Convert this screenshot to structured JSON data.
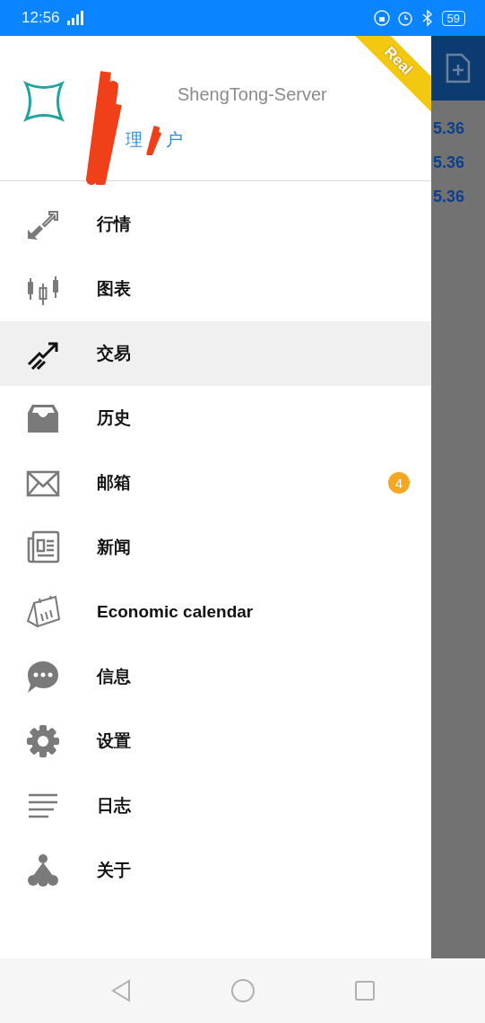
{
  "status_bar": {
    "time": "12:56",
    "battery": "59"
  },
  "account": {
    "server": "ShengTong-Server",
    "manage_link_parts": [
      "理",
      "户"
    ],
    "badge": "Real"
  },
  "menu": [
    {
      "kind": "quotes",
      "label": "行情",
      "selected": false
    },
    {
      "kind": "chart",
      "label": "图表",
      "selected": false
    },
    {
      "kind": "trade",
      "label": "交易",
      "selected": true
    },
    {
      "kind": "history",
      "label": "历史",
      "selected": false
    },
    {
      "kind": "mail",
      "label": "邮箱",
      "selected": false,
      "badge": "4"
    },
    {
      "kind": "news",
      "label": "新闻",
      "selected": false
    },
    {
      "kind": "calendar",
      "label": "Economic calendar",
      "selected": false
    },
    {
      "kind": "chat",
      "label": "信息",
      "selected": false
    },
    {
      "kind": "settings",
      "label": "设置",
      "selected": false
    },
    {
      "kind": "journal",
      "label": "日志",
      "selected": false
    },
    {
      "kind": "about",
      "label": "关于",
      "selected": false
    }
  ],
  "background_screen": {
    "prices": [
      "5.36",
      "5.36",
      "5.36"
    ]
  }
}
